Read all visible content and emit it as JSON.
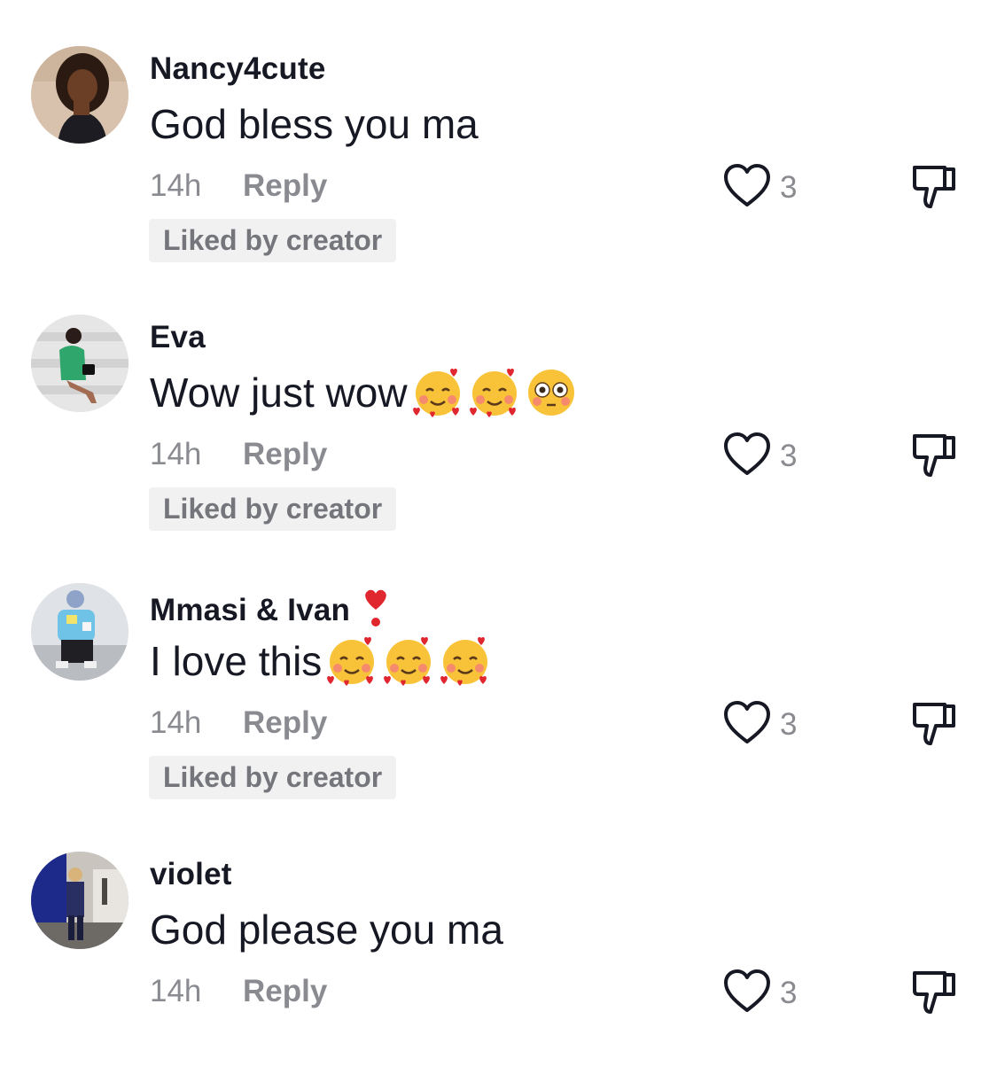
{
  "comments": [
    {
      "username": "Nancy4cute",
      "username_emoji": "",
      "text": "God bless you ma",
      "text_emojis": [],
      "time": "14h",
      "reply_label": "Reply",
      "likes": "3",
      "badge": "Liked by creator"
    },
    {
      "username": "Eva",
      "username_emoji": "",
      "text": "Wow just wow",
      "text_emojis": [
        "smiling-face-with-hearts",
        "smiling-face-with-hearts",
        "flushed-face"
      ],
      "time": "14h",
      "reply_label": "Reply",
      "likes": "3",
      "badge": "Liked by creator"
    },
    {
      "username": "Mmasi & Ivan",
      "username_emoji": "heavy-heart-exclamation",
      "text": "I love this",
      "text_emojis": [
        "smiling-face-with-hearts",
        "smiling-face-with-hearts",
        "smiling-face-with-hearts"
      ],
      "time": "14h",
      "reply_label": "Reply",
      "likes": "3",
      "badge": "Liked by creator"
    },
    {
      "username": "violet",
      "username_emoji": "",
      "text": "God please you ma",
      "text_emojis": [],
      "time": "14h",
      "reply_label": "Reply",
      "likes": "3",
      "badge": ""
    }
  ],
  "icons": {
    "like": "heart-outline-icon",
    "dislike": "thumbs-down-outline-icon"
  },
  "colors": {
    "primary_text": "#161823",
    "secondary_text": "#8a8b91",
    "badge_bg": "#f1f1f2",
    "badge_text": "#75767c"
  }
}
